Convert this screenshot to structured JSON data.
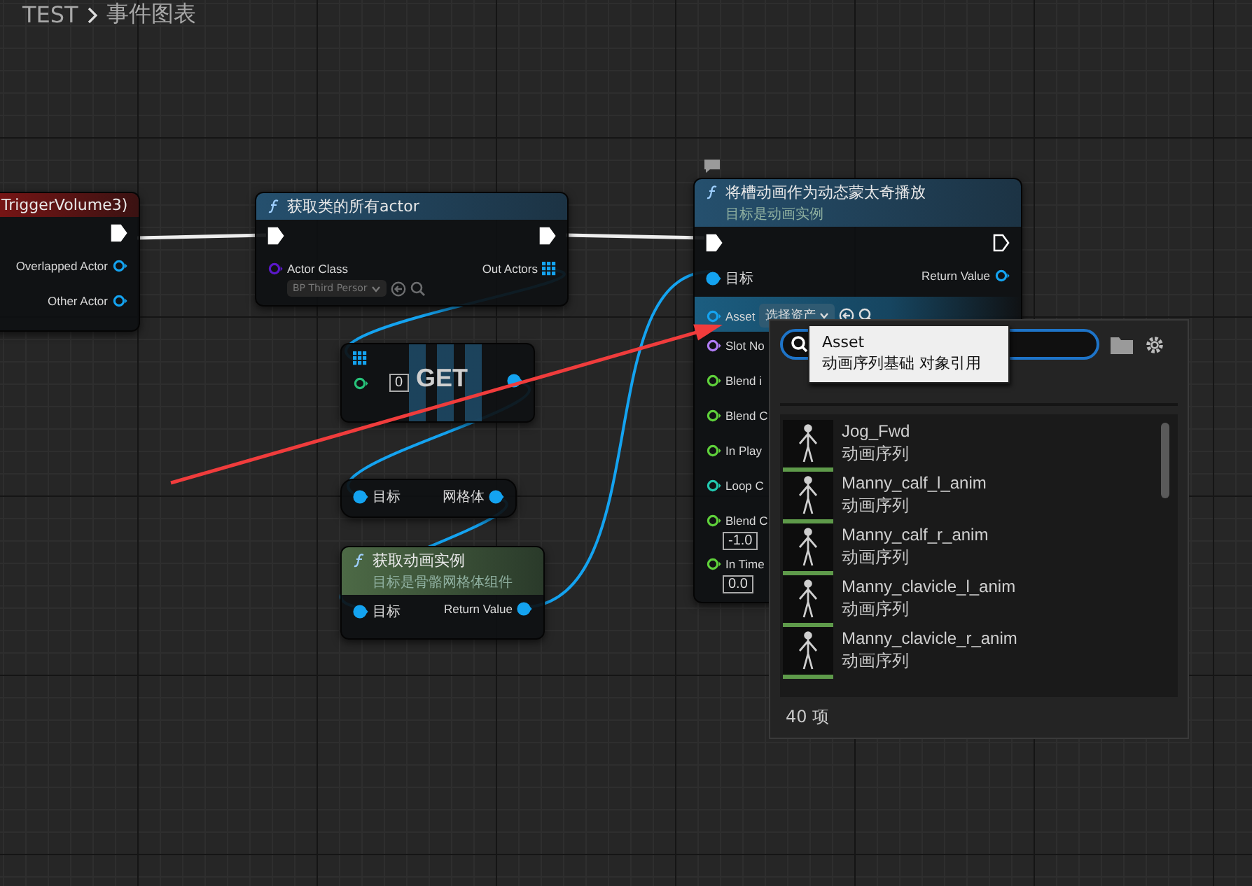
{
  "breadcrumb": [
    "TEST",
    "事件图表"
  ],
  "nodes": [
    {
      "kind": "event",
      "title": "TriggerVolume3)",
      "rows": [
        {
          "right": {
            "kind": "exec",
            "connected": true
          }
        },
        {
          "right": {
            "label": "Overlapped Actor",
            "kind": "object",
            "connected": false
          }
        },
        {
          "right": {
            "label": "Other Actor",
            "kind": "object",
            "connected": false
          }
        }
      ]
    },
    {
      "kind": "function",
      "title": "获取类的所有actor",
      "rows": [
        {
          "left": {
            "kind": "exec",
            "connected": true
          },
          "right": {
            "kind": "exec",
            "connected": true
          }
        },
        {
          "left": {
            "label": "Actor Class",
            "kind": "class",
            "connected": false,
            "dropdown": "BP Third Persor"
          },
          "right": {
            "label": "Out Actors",
            "kind": "array",
            "connected": true
          }
        }
      ]
    },
    {
      "kind": "array_get",
      "label": "GET",
      "rows": [
        {
          "left": {
            "kind": "array",
            "connected": true
          }
        },
        {
          "left": {
            "kind": "index",
            "connected": false,
            "value": "0"
          },
          "right": {
            "kind": "object",
            "connected": true
          }
        }
      ]
    },
    {
      "kind": "member",
      "rows": [
        {
          "left": {
            "label": "目标",
            "kind": "object",
            "connected": true
          },
          "right": {
            "label": "网格体",
            "kind": "object",
            "connected": true
          }
        }
      ]
    },
    {
      "kind": "pure_function",
      "title": "获取动画实例",
      "subtitle": "目标是骨骼网格体组件",
      "rows": [
        {
          "left": {
            "label": "目标",
            "kind": "object",
            "connected": true
          },
          "right": {
            "label": "Return Value",
            "kind": "object",
            "connected": true
          }
        }
      ]
    },
    {
      "kind": "function",
      "title": "将槽动画作为动态蒙太奇播放",
      "subtitle": "目标是动画实例",
      "rows": [
        {
          "left": {
            "kind": "exec",
            "connected": true
          },
          "right": {
            "kind": "exec",
            "connected": false
          }
        },
        {
          "left": {
            "label": "目标",
            "kind": "object",
            "connected": true
          },
          "right": {
            "label": "Return Value",
            "kind": "object",
            "connected": false
          }
        },
        {
          "highlighted": true,
          "left": {
            "label": "Asset",
            "kind": "object",
            "connected": false,
            "dropdown": "选择资产"
          }
        },
        {
          "left": {
            "label": "Slot No",
            "kind": "name",
            "connected": false
          }
        },
        {
          "left": {
            "label": "Blend i",
            "kind": "float",
            "connected": false
          }
        },
        {
          "left": {
            "label": "Blend C",
            "kind": "float",
            "connected": false
          }
        },
        {
          "left": {
            "label": "In Play",
            "kind": "float",
            "connected": false
          }
        },
        {
          "left": {
            "label": "Loop C",
            "kind": "int",
            "connected": false
          }
        },
        {
          "left": {
            "label": "Blend C",
            "kind": "float",
            "connected": false,
            "value": "-1.0"
          }
        },
        {
          "left": {
            "label": "In Time",
            "kind": "float",
            "connected": false,
            "value": "0.0"
          }
        }
      ]
    }
  ],
  "asset_picker": {
    "items": [
      {
        "name": "Jog_Fwd",
        "type": "动画序列"
      },
      {
        "name": "Manny_calf_l_anim",
        "type": "动画序列"
      },
      {
        "name": "Manny_calf_r_anim",
        "type": "动画序列"
      },
      {
        "name": "Manny_clavicle_l_anim",
        "type": "动画序列"
      },
      {
        "name": "Manny_clavicle_r_anim",
        "type": "动画序列"
      }
    ],
    "count": "40 项"
  },
  "tooltip": {
    "title": "Asset",
    "text": "动画序列基础 对象引用"
  }
}
